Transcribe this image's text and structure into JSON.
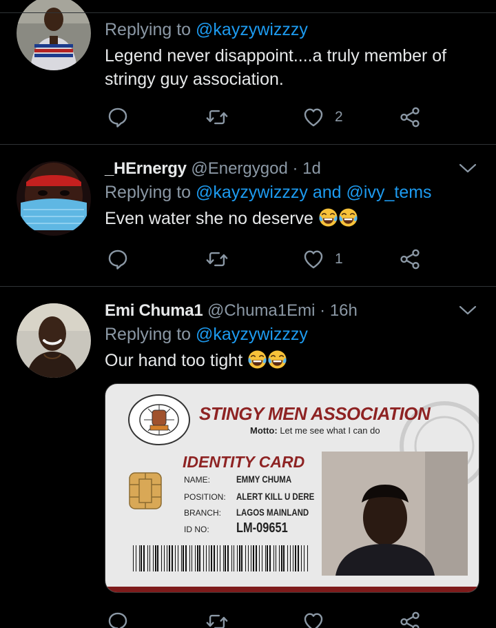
{
  "tweets": [
    {
      "display_name": "",
      "reply_prefix": "Replying to ",
      "mentions": [
        "@kayzywizzzy"
      ],
      "text": "Legend never disappoint....a truly member of stringy guy association.",
      "likes": "2"
    },
    {
      "display_name": "_HErnergy",
      "handle": "@Energygod",
      "time": "1d",
      "reply_prefix": "Replying to ",
      "mentions": [
        "@kayzywizzzy",
        "@ivy_tems"
      ],
      "mention_join": " and ",
      "text": "Even water she no deserve",
      "likes": "1"
    },
    {
      "display_name": "Emi Chuma1",
      "handle": "@Chuma1Emi",
      "time": "16h",
      "reply_prefix": "Replying to ",
      "mentions": [
        "@kayzywizzzy"
      ],
      "text": "Our hand too tight",
      "card": {
        "title": "STINGY MEN ASSOCIATION",
        "motto_label": "Motto:",
        "motto": "Let me see what I can do",
        "id_title": "IDENTITY CARD",
        "fields": [
          {
            "label": "NAME:",
            "value": "EMMY CHUMA"
          },
          {
            "label": "POSITION:",
            "value": "ALERT KILL U DERE"
          },
          {
            "label": "BRANCH:",
            "value": "LAGOS MAINLAND"
          },
          {
            "label": "ID NO:",
            "value": "LM-09651"
          }
        ],
        "logo_text_top": "STINGY MEN ASSOCIATION OF NIGERIA",
        "logo_badge": "SMAN",
        "logo_text_bottom": "DON'T GIVE SH3 SH3"
      }
    }
  ],
  "dot": "·",
  "icons": [
    "reply-icon",
    "retweet-icon",
    "like-icon",
    "share-icon",
    "caret-down-icon",
    "tears-of-joy-emoji"
  ],
  "colors": {
    "background": "#000000",
    "text": "#e7e9ea",
    "muted": "#8b98a5",
    "link": "#1d9bf0",
    "divider": "#2f3336",
    "card_red": "#8e2323"
  }
}
